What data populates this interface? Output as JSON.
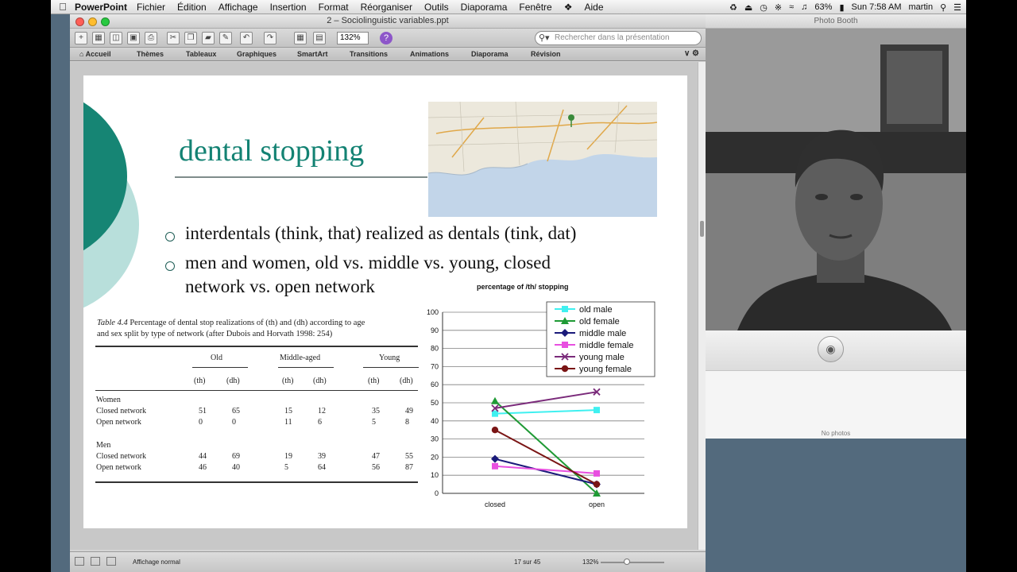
{
  "menubar": {
    "app_name": "PowerPoint",
    "items": [
      "Fichier",
      "Édition",
      "Affichage",
      "Insertion",
      "Format",
      "Réorganiser",
      "Outils",
      "Diaporama",
      "Fenêtre",
      "Aide"
    ],
    "battery": "63%",
    "clock": "Sun 7:58 AM",
    "user": "martin"
  },
  "ppt": {
    "window_title": "2 – Sociolinguistic variables.ppt",
    "zoom": "132%",
    "search_placeholder": "Rechercher dans la présentation",
    "ribbon_tabs": [
      "Accueil",
      "Thèmes",
      "Tableaux",
      "Graphiques",
      "SmartArt",
      "Transitions",
      "Animations",
      "Diaporama",
      "Révision"
    ],
    "status": {
      "view": "Affichage normal",
      "slide_pos": "17 sur 45",
      "zoom": "132%"
    }
  },
  "slide": {
    "title": "dental stopping",
    "bullets": [
      "interdentals (think, that) realized as dentals (tink, dat)",
      "men and women, old vs. middle vs. young, closed",
      "network vs. open network"
    ]
  },
  "table": {
    "caption_num": "Table 4.4",
    "caption_line1": "Percentage of dental stop realizations of (th) and (dh) according to age",
    "caption_line2": "and sex split by type of network (after Dubois and Horvath 1998: 254)",
    "groups": [
      "Old",
      "Middle-aged",
      "Young"
    ],
    "subcols": [
      "(th)",
      "(dh)",
      "(th)",
      "(dh)",
      "(th)",
      "(dh)"
    ],
    "sections": [
      {
        "label": "Women",
        "rows": [
          {
            "label": "Closed network",
            "values": [
              "51",
              "65",
              "15",
              "12",
              "35",
              "49"
            ]
          },
          {
            "label": "Open network",
            "values": [
              "0",
              "0",
              "11",
              "6",
              "5",
              "8"
            ]
          }
        ]
      },
      {
        "label": "Men",
        "rows": [
          {
            "label": "Closed network",
            "values": [
              "44",
              "69",
              "19",
              "39",
              "47",
              "55"
            ]
          },
          {
            "label": "Open network",
            "values": [
              "46",
              "40",
              "5",
              "64",
              "56",
              "87"
            ]
          }
        ]
      }
    ]
  },
  "chart_data": {
    "type": "line",
    "title": "percentage of /th/ stopping",
    "categories": [
      "closed",
      "open"
    ],
    "ylim": [
      0,
      100
    ],
    "yticks": [
      0,
      10,
      20,
      30,
      40,
      50,
      60,
      70,
      80,
      90,
      100
    ],
    "grid": true,
    "legend_position": "top-right",
    "series": [
      {
        "name": "old male",
        "values": [
          44,
          46
        ],
        "color": "#3ff0f0",
        "marker": "square"
      },
      {
        "name": "old female",
        "values": [
          51,
          0
        ],
        "color": "#1f9a35",
        "marker": "triangle"
      },
      {
        "name": "middle male",
        "values": [
          19,
          5
        ],
        "color": "#1a1a7a",
        "marker": "diamond"
      },
      {
        "name": "middle female",
        "values": [
          15,
          11
        ],
        "color": "#e84fe0",
        "marker": "square"
      },
      {
        "name": "young male",
        "values": [
          47,
          56
        ],
        "color": "#7a2a7a",
        "marker": "x"
      },
      {
        "name": "young female",
        "values": [
          35,
          5
        ],
        "color": "#7a1515",
        "marker": "circle"
      }
    ]
  },
  "photobooth": {
    "title": "Photo Booth",
    "tray_text": "No photos"
  }
}
